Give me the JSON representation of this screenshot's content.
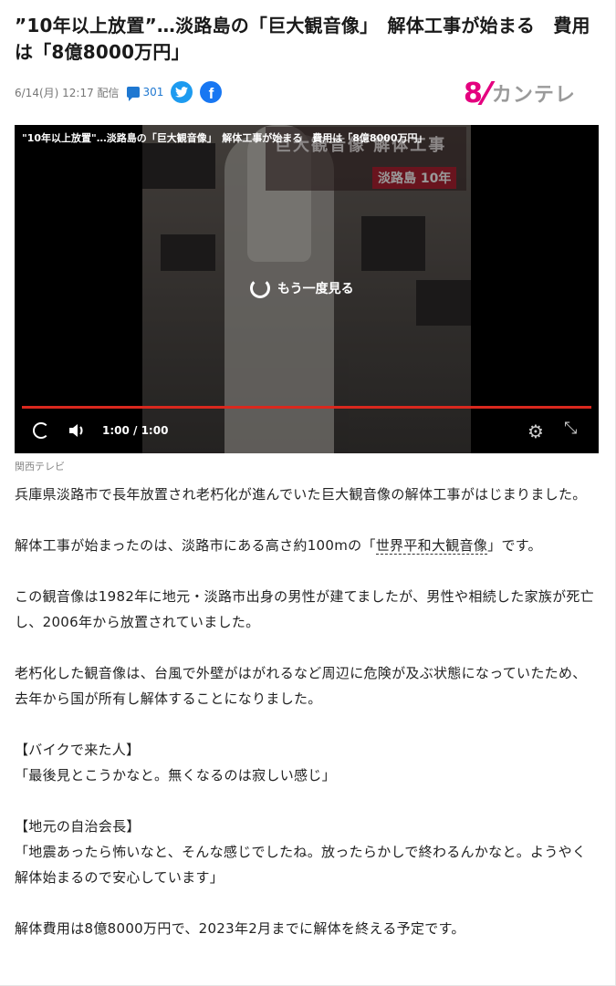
{
  "article": {
    "headline": "”10年以上放置”…淡路島の「巨大観音像」　解体工事が始まる　費用は「8億8000万円」",
    "date": "6/14(月) 12:17 配信",
    "comment_count": "301",
    "social": {
      "twitter": "twitter-icon",
      "facebook": "facebook-icon"
    }
  },
  "logo": {
    "mark": "8",
    "name": "カンテレ",
    "color": "#e4007f"
  },
  "video": {
    "title": "\"10年以上放置\"…淡路島の「巨大観音像」　解体工事が始まる　費用は「8億8000万円」",
    "thumb_caption_1": "巨大観音像 解体工事",
    "thumb_caption_2": "淡路島 10年",
    "replay_label": "もう一度見る",
    "time": "1:00 / 1:00",
    "progress": 1.0,
    "progress_color": "#d9281e"
  },
  "credit": "関西テレビ",
  "body": {
    "p1": "兵庫県淡路市で長年放置され老朽化が進んでいた巨大観音像の解体工事がはじまりました。",
    "p2_before": "解体工事が始まったのは、淡路市にある高さ約100mの「",
    "p2_link": "世界平和大観音像",
    "p2_after": "」です。",
    "p3": "この観音像は1982年に地元・淡路市出身の男性が建てましたが、男性や相続した家族が死亡し、2006年から放置されていました。",
    "p4": "老朽化した観音像は、台風で外壁がはがれるなど周辺に危険が及ぶ状態になっていたため、去年から国が所有し解体することになりました。",
    "q1_heading": "【バイクで来た人】",
    "q1_text": "「最後見とこうかなと。無くなるのは寂しい感じ」",
    "q2_heading": "【地元の自治会長】",
    "q2_text": "「地震あったら怖いなと、そんな感じでしたね。放ったらかしで終わるんかなと。ようやく解体始まるので安心しています」",
    "p5": "解体費用は8億8000万円で、2023年2月までに解体を終える予定です。"
  }
}
